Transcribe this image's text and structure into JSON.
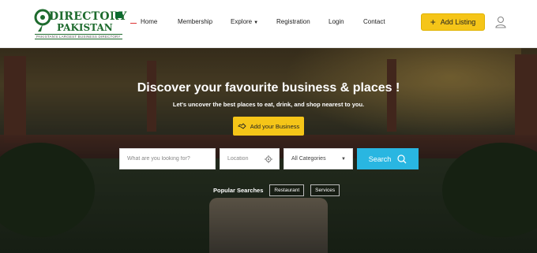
{
  "header": {
    "logo": {
      "line1": "DIRECTORY",
      "line2": "PAKISTAN",
      "tagline": "PAKISTAN'S LARGEST BUSINESS DIRECTORY",
      "brand_color": "#1e6b2e"
    },
    "nav": [
      {
        "label": "Home"
      },
      {
        "label": "Membership"
      },
      {
        "label": "Explore",
        "dropdown": true
      },
      {
        "label": "Registration"
      },
      {
        "label": "Login"
      },
      {
        "label": "Contact"
      }
    ],
    "add_listing_label": "Add Listing",
    "accent_color": "#f5c518",
    "user_icon": "user-icon"
  },
  "hero": {
    "title": "Discover your favourite business & places !",
    "subtitle": "Let's uncover the best places to eat, drink, and shop nearest to you.",
    "add_business_label": "Add your Business",
    "search": {
      "what_placeholder": "What are you looking for?",
      "location_placeholder": "Location",
      "category_selected": "All Categories",
      "button_label": "Search",
      "button_color": "#29b6e1"
    },
    "popular": {
      "label": "Popular Searches",
      "tags": [
        "Restaurant",
        "Services"
      ]
    }
  }
}
